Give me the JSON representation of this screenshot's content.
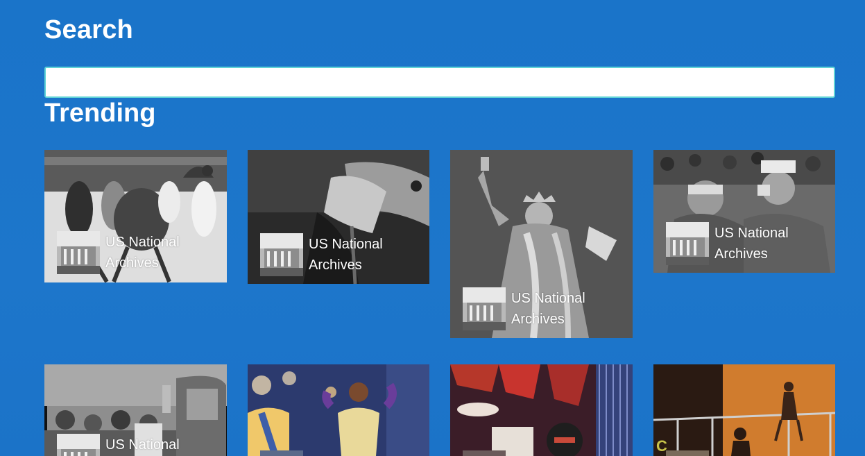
{
  "search": {
    "title": "Search",
    "placeholder": "",
    "value": ""
  },
  "trending": {
    "title": "Trending",
    "items": [
      {
        "attribution": "US National Archives",
        "theme": "grayscale",
        "subject": "ice-skaters"
      },
      {
        "attribution": "US National Archives",
        "theme": "grayscale",
        "subject": "hands-working"
      },
      {
        "attribution": "US National Archives",
        "theme": "grayscale",
        "subject": "statue-of-liberty"
      },
      {
        "attribution": "US National Archives",
        "theme": "grayscale",
        "subject": "soldiers-drinking"
      },
      {
        "attribution": "US National Archives",
        "theme": "grayscale",
        "subject": "crowd-bus"
      },
      {
        "attribution": "",
        "theme": "color",
        "subject": "dancer-street"
      },
      {
        "attribution": "",
        "theme": "color",
        "subject": "stage-performers"
      },
      {
        "attribution": "",
        "theme": "color",
        "subject": "stage-dancers"
      }
    ]
  },
  "colors": {
    "background": "#1b74c9",
    "search_border": "#5fd3d6",
    "text": "#ffffff"
  }
}
